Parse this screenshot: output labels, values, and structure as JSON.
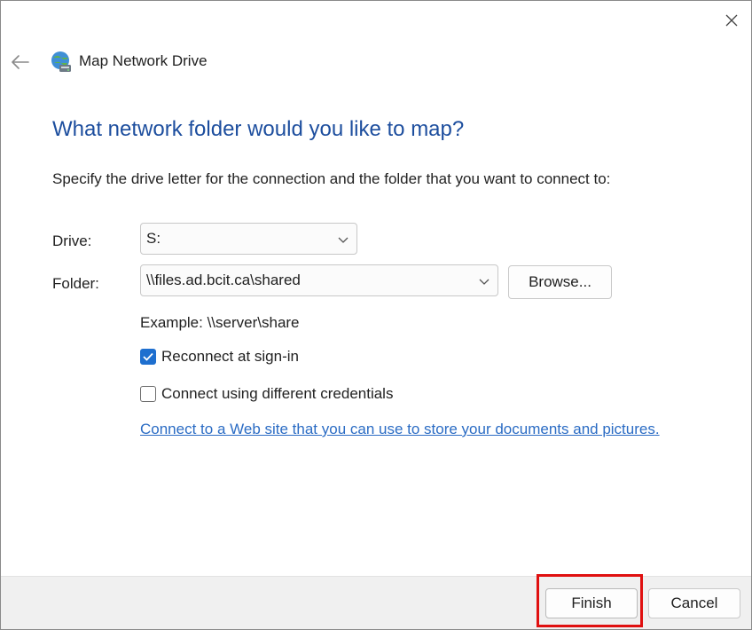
{
  "window": {
    "title": "Map Network Drive",
    "close_icon": "close-icon",
    "back_icon": "back-arrow-icon",
    "app_icon": "network-drive-icon"
  },
  "main": {
    "heading": "What network folder would you like to map?",
    "instruction": "Specify the drive letter for the connection and the folder that you want to connect to:"
  },
  "drive": {
    "label": "Drive:",
    "value": "S:"
  },
  "folder": {
    "label": "Folder:",
    "value": "\\\\files.ad.bcit.ca\\shared"
  },
  "browse_label": "Browse...",
  "example_text": "Example: \\\\server\\share",
  "options": {
    "reconnect": {
      "label": "Reconnect at sign-in",
      "checked": true
    },
    "different_credentials": {
      "label": "Connect using different credentials",
      "checked": false
    }
  },
  "web_link": {
    "text": "Connect to a Web site that you can use to store your documents and pictures",
    "trailing": "."
  },
  "footer": {
    "finish_label": "Finish",
    "cancel_label": "Cancel"
  },
  "colors": {
    "heading": "#1d4e9e",
    "link": "#2b6cc4",
    "checkbox": "#1e6fcf",
    "highlight": "#e01010"
  }
}
